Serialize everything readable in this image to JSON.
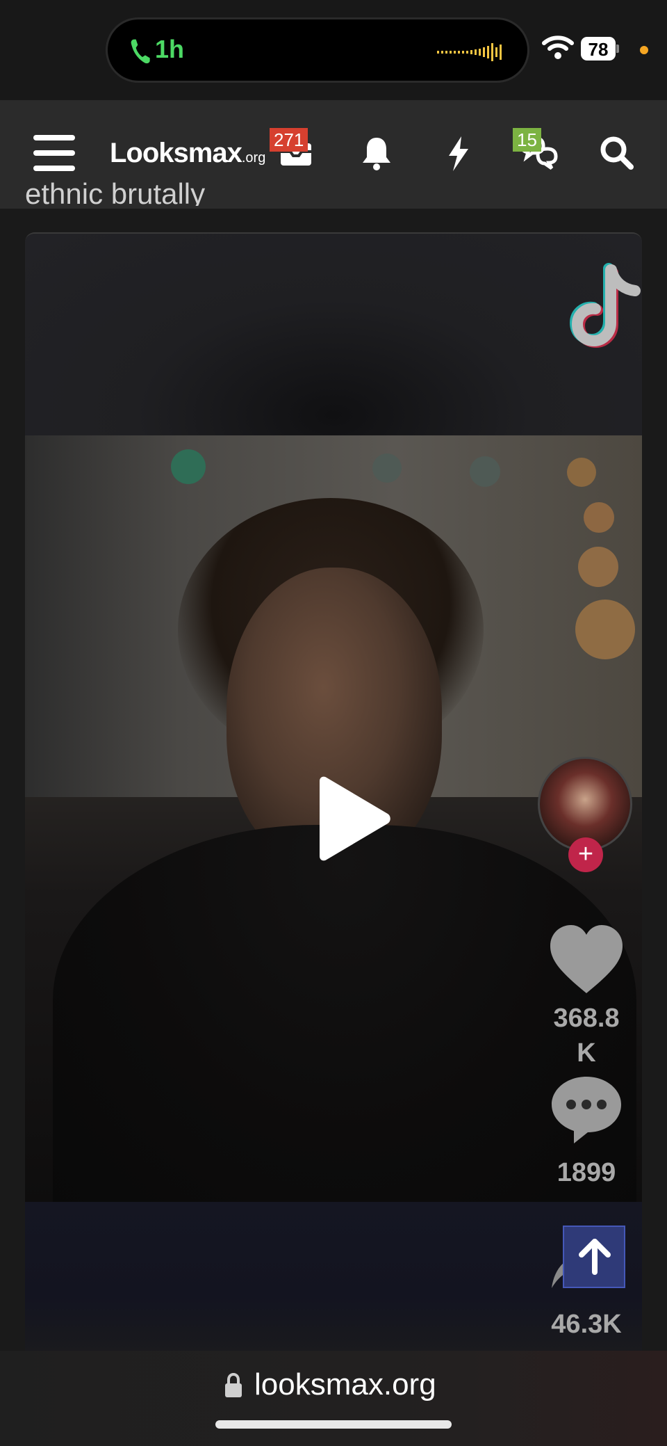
{
  "status_bar": {
    "call_time": "1h",
    "battery": "78"
  },
  "header": {
    "logo_main": "Looksmax",
    "logo_sub": ".org",
    "inbox_badge": "271",
    "conversations_badge": "15"
  },
  "thread": {
    "title": "ethnic brutally"
  },
  "tiktok": {
    "likes": "368.8\nK",
    "likes_line1": "368.8",
    "likes_line2": "K",
    "comments": "1899",
    "shares": "46.3K"
  },
  "browser": {
    "url": "looksmax.org"
  },
  "colors": {
    "accent_red": "#d6402f",
    "accent_green": "#7cb342",
    "call_green": "#4cd964",
    "tiktok_follow": "#c0254a",
    "scroll_top_blue": "#2f3a78"
  },
  "icons": [
    "call-icon",
    "waveform-icon",
    "wifi-icon",
    "hamburger-icon",
    "inbox-icon",
    "bell-icon",
    "lightning-icon",
    "chat-icon",
    "search-icon",
    "tiktok-logo",
    "play-icon",
    "heart-icon",
    "comment-icon",
    "share-icon",
    "arrow-up-icon",
    "lock-icon"
  ]
}
